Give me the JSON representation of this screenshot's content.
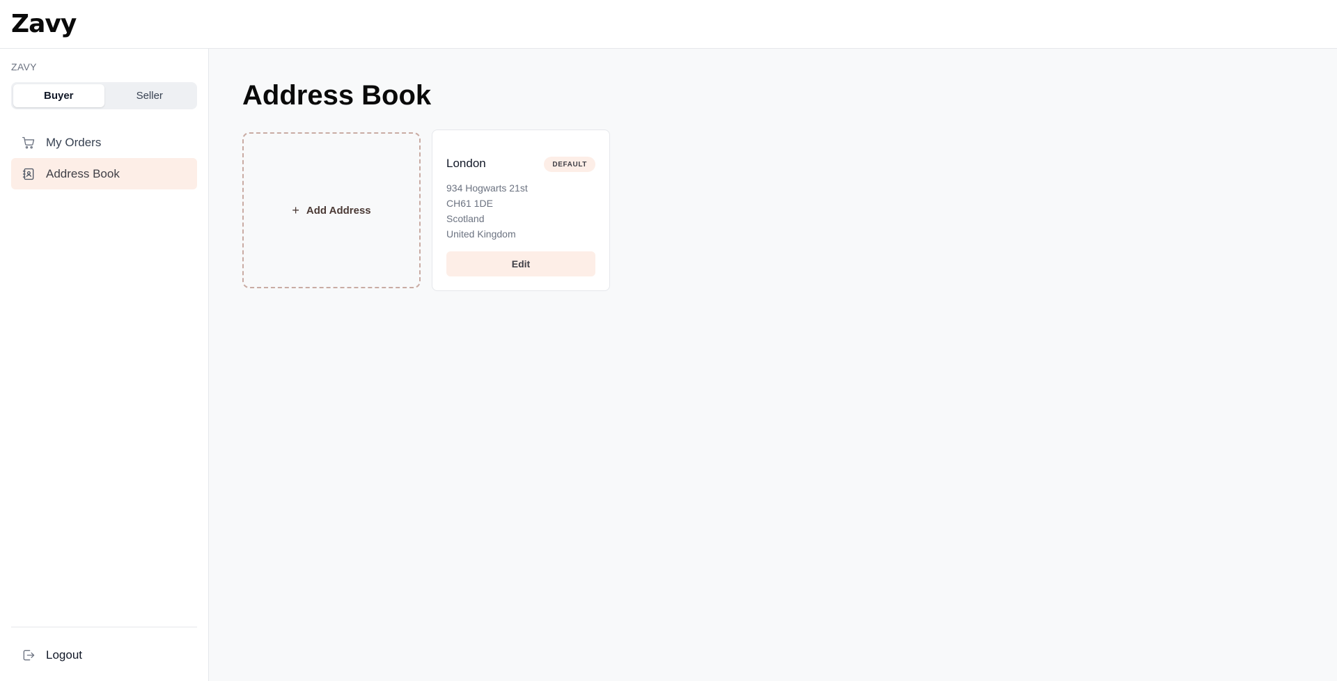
{
  "app": {
    "logo": "Zavy"
  },
  "sidebar": {
    "section_label": "ZAVY",
    "toggle": {
      "buyer": "Buyer",
      "seller": "Seller",
      "active": "Buyer"
    },
    "items": [
      {
        "label": "My Orders",
        "icon": "cart-icon"
      },
      {
        "label": "Address Book",
        "icon": "address-book-icon",
        "active": true
      }
    ],
    "logout": {
      "label": "Logout",
      "icon": "logout-icon"
    }
  },
  "main": {
    "title": "Address Book",
    "add_card": {
      "label": "Add Address",
      "icon": "plus-icon"
    },
    "addresses": [
      {
        "name": "London",
        "badge": "DEFAULT",
        "line1": "934 Hogwarts 21st",
        "line2": "CH61 1DE",
        "line3": "Scotland",
        "line4": "United Kingdom",
        "edit_label": "Edit"
      }
    ]
  },
  "colors": {
    "accent_bg": "#fdeee7",
    "page_bg": "#f8f9fa",
    "dashed_border": "#c9aba3"
  }
}
